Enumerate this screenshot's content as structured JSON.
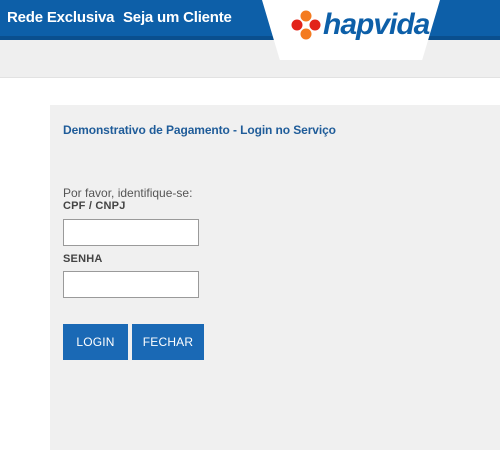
{
  "header": {
    "nav": [
      {
        "label": "Rede Exclusiva"
      },
      {
        "label": "Seja um Cliente"
      }
    ],
    "logo": {
      "text": "hapvida",
      "icon": "hapvida-flower-icon",
      "colors": {
        "petal_orange": "#f47b20",
        "petal_red": "#e2231a",
        "text_blue": "#0d5fa8"
      }
    }
  },
  "colors": {
    "topbar": "#0d5fa8",
    "button": "#1a69b5",
    "panel": "#f0f0f0",
    "title": "#1f5c99"
  },
  "form": {
    "title": "Demonstrativo de Pagamento - Login no Serviço",
    "prompt": "Por favor, identifique-se:",
    "cpf_label": "CPF / CNPJ",
    "cpf_value": "",
    "senha_label": "SENHA",
    "senha_value": "",
    "login_button": "LOGIN",
    "fechar_button": "FECHAR"
  }
}
